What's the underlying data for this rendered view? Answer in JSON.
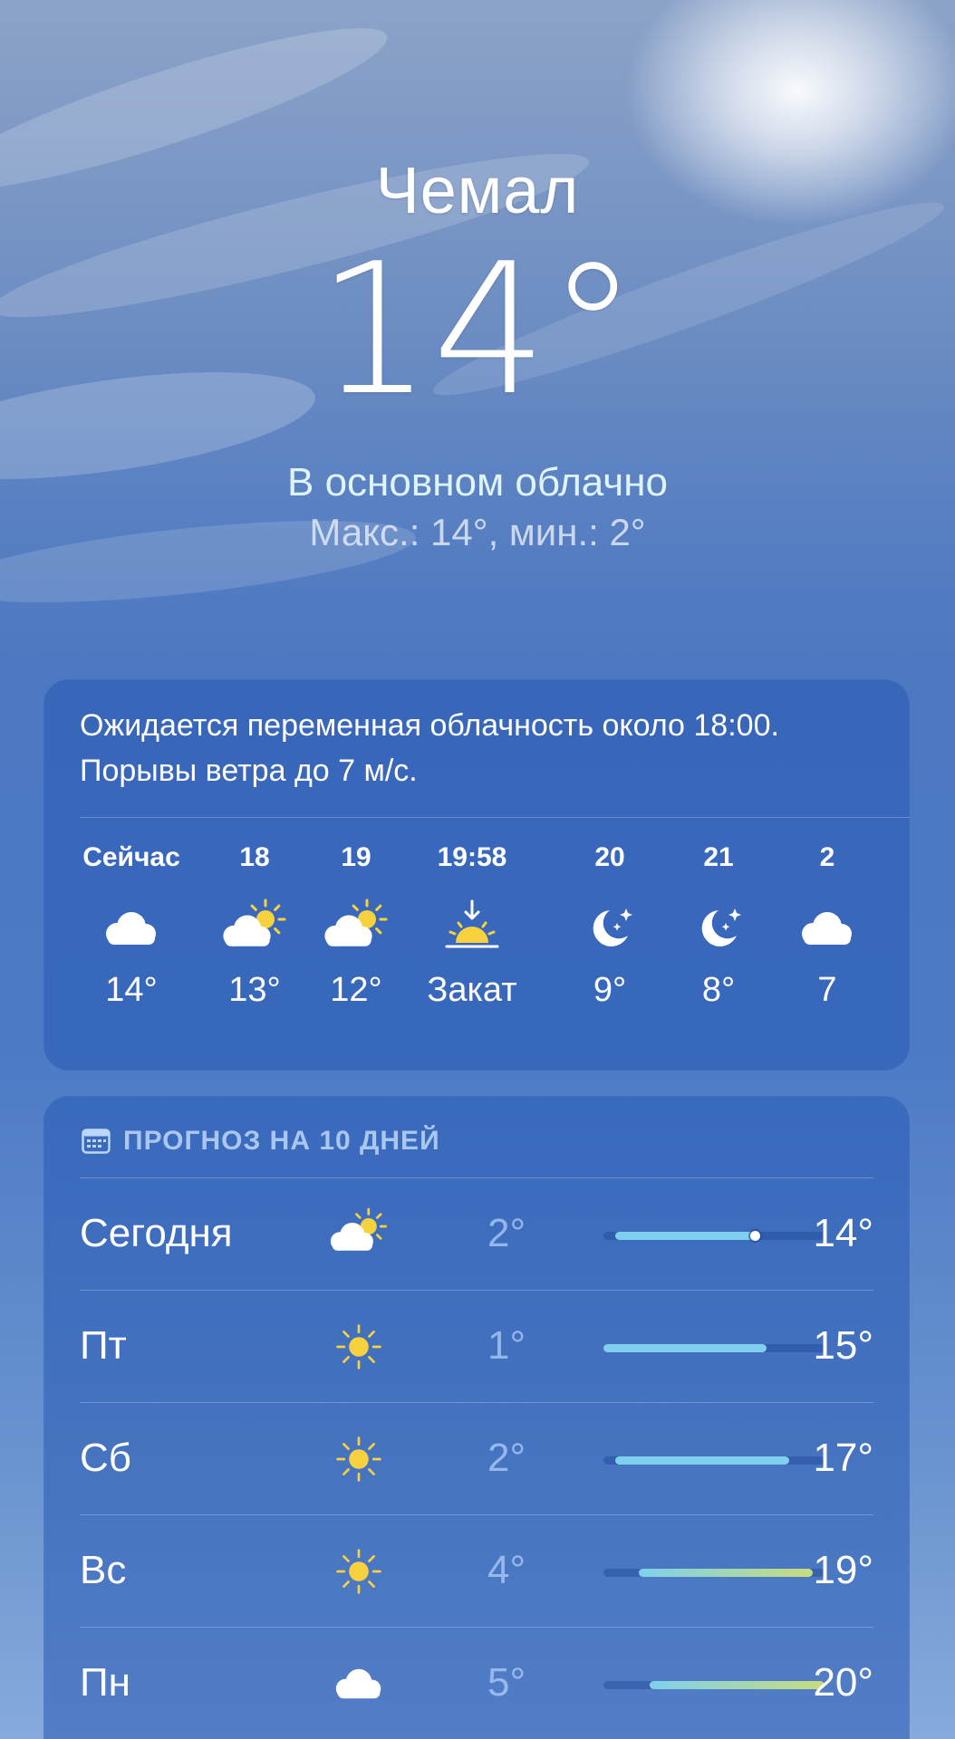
{
  "header": {
    "city": "Чемал",
    "temperature": "14°",
    "condition": "В основном облачно",
    "hi_lo": "Макс.: 14°, мин.: 2°"
  },
  "hourly": {
    "summary_line1": "Ожидается переменная облачность около 18:00.",
    "summary_line2": "Порывы ветра до 7 м/с.",
    "items": [
      {
        "time": "Сейчас",
        "icon": "cloud-icon",
        "value": "14°"
      },
      {
        "time": "18",
        "icon": "partly-sunny-icon",
        "value": "13°"
      },
      {
        "time": "19",
        "icon": "partly-sunny-icon",
        "value": "12°"
      },
      {
        "time": "19:58",
        "icon": "sunset-icon",
        "value": "Закат"
      },
      {
        "time": "20",
        "icon": "moon-stars-icon",
        "value": "9°"
      },
      {
        "time": "21",
        "icon": "moon-stars-icon",
        "value": "8°"
      },
      {
        "time": "2",
        "icon": "cloud-icon",
        "value": "7"
      }
    ]
  },
  "daily": {
    "title": "ПРОГНОЗ НА 10 ДНЕЙ",
    "range_min": 1,
    "range_max": 20,
    "items": [
      {
        "day": "Сегодня",
        "icon": "partly-sunny-icon",
        "low": "2°",
        "high": "14°",
        "low_val": 2,
        "high_val": 14,
        "current_val": 14
      },
      {
        "day": "Пт",
        "icon": "sun-icon",
        "low": "1°",
        "high": "15°",
        "low_val": 1,
        "high_val": 15
      },
      {
        "day": "Сб",
        "icon": "sun-icon",
        "low": "2°",
        "high": "17°",
        "low_val": 2,
        "high_val": 17
      },
      {
        "day": "Вс",
        "icon": "sun-icon",
        "low": "4°",
        "high": "19°",
        "low_val": 4,
        "high_val": 19
      },
      {
        "day": "Пн",
        "icon": "cloud-icon",
        "low": "5°",
        "high": "20°",
        "low_val": 5,
        "high_val": 20
      }
    ]
  },
  "colors": {
    "sun": "#f7d23e",
    "bar_cool": "#7fd0ee",
    "bar_warm": "#c8dc7a"
  }
}
